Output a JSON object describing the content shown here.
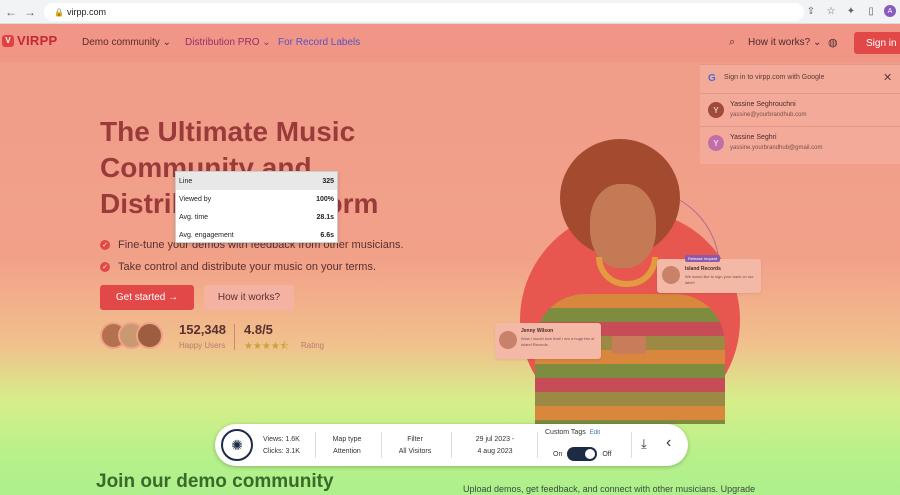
{
  "browser": {
    "url": "virpp.com",
    "back_icon": "←",
    "forward_icon": "→",
    "reload_icon": "⟳",
    "profile_initial": "A"
  },
  "site": {
    "logo_text": "VIRPP",
    "logo_mark": "V",
    "nav": {
      "demo": "Demo community ⌄",
      "distribution": "Distribution PRO ⌄",
      "labels": "For Record Labels"
    },
    "how_it_works": "How it works? ⌄",
    "sign_in": "Sign in"
  },
  "hero": {
    "title": "The Ultimate Music Community and Distribution Platform",
    "bullets": [
      "Fine-tune your demos with feedback from other musicians.",
      "Take control and distribute your music on your terms."
    ],
    "get_started": "Get started →",
    "how_it_works": "How it works?",
    "users_count": "152,348",
    "users_label": "Happy Users",
    "rating": "4.8/5",
    "stars": "★★★★⯪",
    "rating_label": "Rating"
  },
  "bubbles": {
    "island_tag": "Release request",
    "island_name": "Island Records",
    "island_text": "We would like to sign your track on our label!",
    "jenny_name": "Jenny Wilson",
    "jenny_text": "Wow I would love that! I am a huge fan of Island Records."
  },
  "google": {
    "logo": "G",
    "title": "Sign in to virpp.com with Google",
    "close": "✕",
    "accounts": [
      {
        "name": "Yassine Seghrouchni",
        "email": "yassine@yourbrandhub.com",
        "initial": "Y"
      },
      {
        "name": "Yassine Seghri",
        "email": "yassine.yourbrandhub@gmail.com",
        "initial": "Y"
      }
    ]
  },
  "tooltip": {
    "rows": [
      {
        "label": "Line",
        "value": "325"
      },
      {
        "label": "Viewed by",
        "value": "100%"
      },
      {
        "label": "Avg. time",
        "value": "28.1s"
      },
      {
        "label": "Avg. engagement",
        "value": "6.6s"
      }
    ]
  },
  "below": {
    "join": "Join our demo community",
    "upload_text": "Upload demos, get feedback, and connect with other musicians. Upgrade"
  },
  "toolbar": {
    "views": "Views: 1.6K",
    "clicks": "Clicks: 3.1K",
    "map_type_label": "Map type",
    "map_type_value": "Attention",
    "filter_label": "Filter",
    "filter_value": "All Visitors",
    "date_line1": "29 jul 2023 -",
    "date_line2": "4 aug 2023",
    "custom_tags": "Custom Tags",
    "edit": "Edit",
    "on": "On",
    "off": "Off"
  },
  "colors": {
    "brand_red": "#e34848",
    "toolbar_dark": "#1c2a44"
  }
}
